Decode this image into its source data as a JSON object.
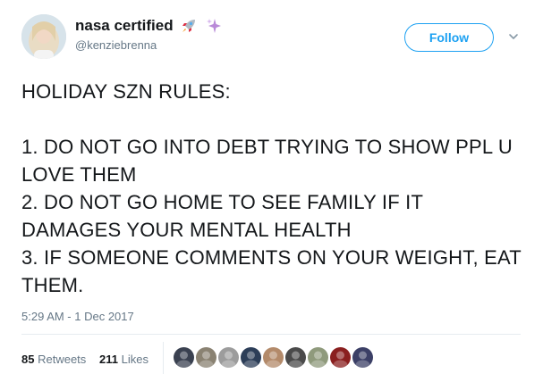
{
  "author": {
    "display_name": "nasa certified",
    "handle": "@kenziebrenna",
    "name_emoji": [
      "rocket-icon",
      "sparkles-icon"
    ]
  },
  "actions": {
    "follow_label": "Follow"
  },
  "tweet": {
    "text": "HOLIDAY SZN RULES:\n\n1. DO NOT GO INTO DEBT TRYING TO SHOW PPL U LOVE THEM\n2. DO NOT GO HOME TO SEE FAMILY IF IT DAMAGES YOUR MENTAL HEALTH\n3. IF SOMEONE COMMENTS ON YOUR WEIGHT, EAT THEM.",
    "timestamp": "5:29 AM - 1 Dec 2017"
  },
  "stats": {
    "retweets_count": "85",
    "retweets_label": "Retweets",
    "likes_count": "211",
    "likes_label": "Likes"
  },
  "likers": [
    {
      "color": "#3a4150"
    },
    {
      "color": "#8a8272"
    },
    {
      "color": "#9c9c9c"
    },
    {
      "color": "#2c3e58"
    },
    {
      "color": "#b38a6a"
    },
    {
      "color": "#4a4a4a"
    },
    {
      "color": "#8f9a7c"
    },
    {
      "color": "#8a1f1f"
    },
    {
      "color": "#3b3f66"
    }
  ],
  "colors": {
    "accent": "#1da1f2",
    "text": "#14171a",
    "secondary_text": "#657786",
    "divider": "#e6ecf0"
  }
}
